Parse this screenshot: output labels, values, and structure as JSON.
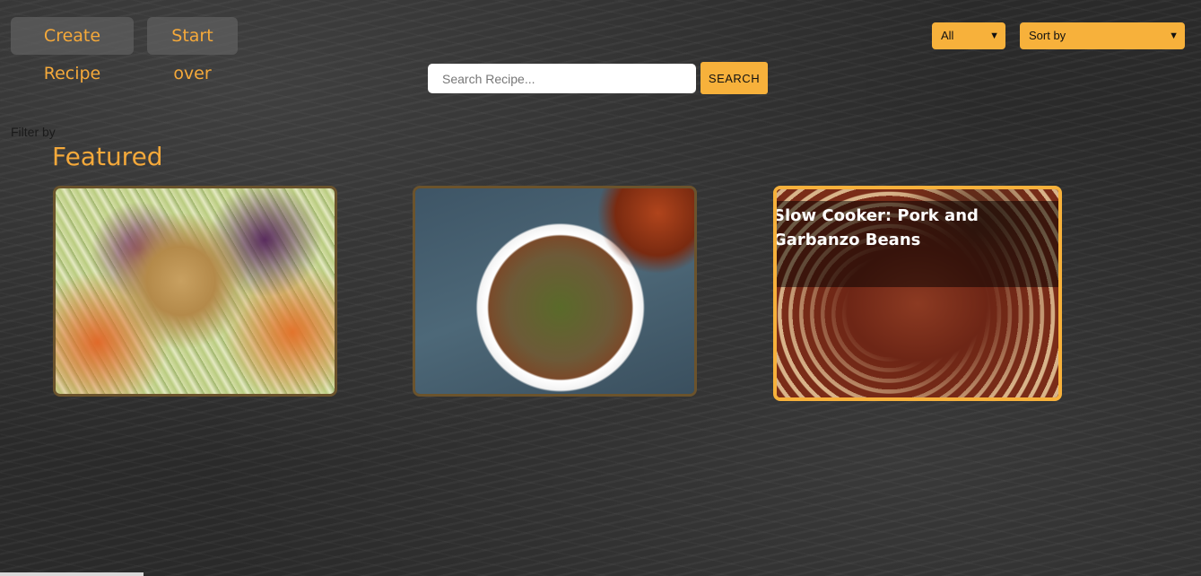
{
  "toolbar": {
    "create_label": "Create Recipe",
    "start_over_label": "Start over"
  },
  "filters": {
    "type_selected": "All",
    "sort_selected": "Sort by",
    "filter_by_label": "Filter by"
  },
  "search": {
    "placeholder": "Search Recipe...",
    "button_label": "SEARCH"
  },
  "featured": {
    "title": "Featured",
    "cards": [
      {
        "title": "",
        "image": "salad-photo"
      },
      {
        "title": "",
        "image": "quinoa-bowl-photo"
      },
      {
        "title": "Slow Cooker: Pork and Garbanzo Beans",
        "image": "pork-beans-photo",
        "highlighted": true
      }
    ]
  },
  "colors": {
    "accent": "#f7b13b",
    "accent_text": "#f5a93a",
    "background": "#2a2a2a",
    "button_bg": "#5f5f5f"
  }
}
